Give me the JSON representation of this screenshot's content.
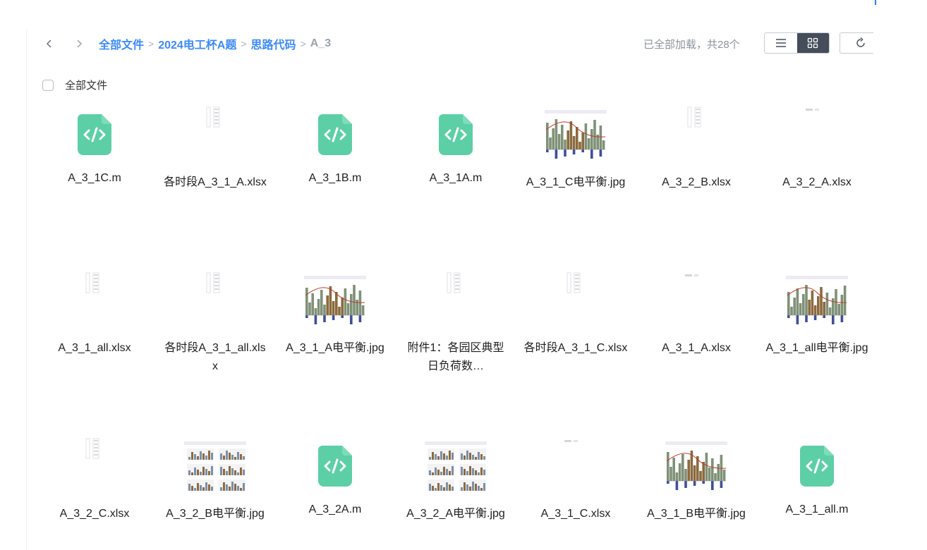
{
  "breadcrumb": {
    "items": [
      "全部文件",
      "2024电工杯A题",
      "思路代码"
    ],
    "separator": ">",
    "current": "A_3"
  },
  "status": "已全部加载，共28个",
  "select_all_label": "全部文件",
  "colors": {
    "accent": "#3d8af7",
    "code_icon": "#5ccfa6",
    "muted": "#9aa3ae"
  },
  "files": [
    {
      "name": "A_3_1C.m",
      "type": "code"
    },
    {
      "name": "各时段A_3_1_A.xlsx",
      "type": "xlsx"
    },
    {
      "name": "A_3_1B.m",
      "type": "code"
    },
    {
      "name": "A_3_1A.m",
      "type": "code"
    },
    {
      "name": "A_3_1_C电平衡.jpg",
      "type": "image"
    },
    {
      "name": "A_3_2_B.xlsx",
      "type": "xlsx"
    },
    {
      "name": "A_3_2_A.xlsx",
      "type": "xlsx"
    },
    {
      "name": "A_3_1_all.xlsx",
      "type": "xlsx"
    },
    {
      "name": "各时段A_3_1_all.xlsx",
      "type": "xlsx"
    },
    {
      "name": "A_3_1_A电平衡.jpg",
      "type": "image"
    },
    {
      "name": "附件1：各园区典型日负荷数…",
      "type": "xlsx"
    },
    {
      "name": "各时段A_3_1_C.xlsx",
      "type": "xlsx"
    },
    {
      "name": "A_3_1_A.xlsx",
      "type": "xlsx"
    },
    {
      "name": "A_3_1_all电平衡.jpg",
      "type": "image"
    },
    {
      "name": "A_3_2_C.xlsx",
      "type": "xlsx"
    },
    {
      "name": "A_3_2_B电平衡.jpg",
      "type": "image"
    },
    {
      "name": "A_3_2A.m",
      "type": "code"
    },
    {
      "name": "A_3_2_A电平衡.jpg",
      "type": "image"
    },
    {
      "name": "A_3_1_C.xlsx",
      "type": "xlsx"
    },
    {
      "name": "A_3_1_B电平衡.jpg",
      "type": "image"
    },
    {
      "name": "A_3_1_all.m",
      "type": "code"
    }
  ]
}
